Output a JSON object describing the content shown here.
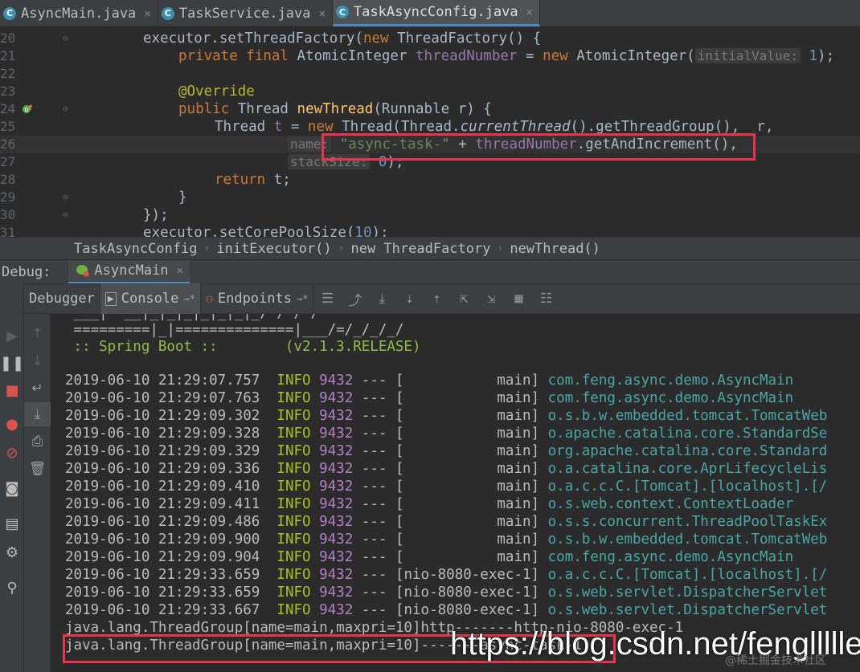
{
  "tabs": [
    {
      "label": "AsyncMain.java",
      "active": false
    },
    {
      "label": "TaskService.java",
      "active": false
    },
    {
      "label": "TaskAsyncConfig.java",
      "active": true
    }
  ],
  "editor": {
    "lines": [
      {
        "num": "20",
        "t1": "executor.setThreadFactory(",
        "t2": "new",
        "t3": " ThreadFactory() {"
      },
      {
        "num": "21",
        "t1": "private final",
        "t2": " AtomicInteger ",
        "t3": "threadNumber",
        "t4": " = ",
        "t5": "new",
        "t6": " AtomicInteger(",
        "hint": "initialValue:",
        "t7": " 1",
        "t8": ");"
      },
      {
        "num": "22"
      },
      {
        "num": "23",
        "t1": "@Override"
      },
      {
        "num": "24",
        "t1": "public",
        "t2": " Thread ",
        "t3": "newThread",
        "t4": "(Runnable r) {"
      },
      {
        "num": "25",
        "t1": "Thread ",
        "t2": "t",
        "t3": " = ",
        "t4": "new",
        "t5": " Thread(Thread.",
        "t6": "currentThread",
        "t7": "().getThreadGroup(),  r,"
      },
      {
        "num": "26",
        "hint": "name:",
        "t1": " \"async-task-\"",
        "t2": " + ",
        "t3": "threadNumber",
        "t4": ".getAndIncrement(),"
      },
      {
        "num": "27",
        "hint": "stackSize:",
        "t1": " 0",
        "t2": ");"
      },
      {
        "num": "28",
        "t1": "return",
        "t2": " t;"
      },
      {
        "num": "29",
        "t1": "}"
      },
      {
        "num": "30",
        "t1": "});"
      },
      {
        "num": "31",
        "t1": "executor.setCorePoolSize(",
        "t2": "10",
        "t3": ");"
      }
    ]
  },
  "breadcrumb": [
    "TaskAsyncConfig",
    "initExecutor()",
    "new ThreadFactory",
    "newThread()"
  ],
  "debug": {
    "label": "Debug:",
    "run_tab": "AsyncMain",
    "tabs": [
      "Debugger",
      "Console",
      "Endpoints"
    ]
  },
  "console": {
    "banner1": " =========|_|==============|___/=/_/_/_/",
    "banner2": " :: Spring Boot ::        (v2.1.3.RELEASE)",
    "logs": [
      {
        "ts": "2019-06-10 21:29:07.757",
        "level": "INFO",
        "pid": "9432",
        "thread": "[           main]",
        "cls": "com.feng.async.demo.AsyncMain"
      },
      {
        "ts": "2019-06-10 21:29:07.763",
        "level": "INFO",
        "pid": "9432",
        "thread": "[           main]",
        "cls": "com.feng.async.demo.AsyncMain"
      },
      {
        "ts": "2019-06-10 21:29:09.302",
        "level": "INFO",
        "pid": "9432",
        "thread": "[           main]",
        "cls": "o.s.b.w.embedded.tomcat.TomcatWeb"
      },
      {
        "ts": "2019-06-10 21:29:09.328",
        "level": "INFO",
        "pid": "9432",
        "thread": "[           main]",
        "cls": "o.apache.catalina.core.StandardSe"
      },
      {
        "ts": "2019-06-10 21:29:09.329",
        "level": "INFO",
        "pid": "9432",
        "thread": "[           main]",
        "cls": "org.apache.catalina.core.Standard"
      },
      {
        "ts": "2019-06-10 21:29:09.336",
        "level": "INFO",
        "pid": "9432",
        "thread": "[           main]",
        "cls": "o.a.catalina.core.AprLifecycleLis"
      },
      {
        "ts": "2019-06-10 21:29:09.410",
        "level": "INFO",
        "pid": "9432",
        "thread": "[           main]",
        "cls": "o.a.c.c.C.[Tomcat].[localhost].[/"
      },
      {
        "ts": "2019-06-10 21:29:09.411",
        "level": "INFO",
        "pid": "9432",
        "thread": "[           main]",
        "cls": "o.s.web.context.ContextLoader"
      },
      {
        "ts": "2019-06-10 21:29:09.486",
        "level": "INFO",
        "pid": "9432",
        "thread": "[           main]",
        "cls": "o.s.s.concurrent.ThreadPoolTaskEx"
      },
      {
        "ts": "2019-06-10 21:29:09.900",
        "level": "INFO",
        "pid": "9432",
        "thread": "[           main]",
        "cls": "o.s.b.w.embedded.tomcat.TomcatWeb"
      },
      {
        "ts": "2019-06-10 21:29:09.904",
        "level": "INFO",
        "pid": "9432",
        "thread": "[           main]",
        "cls": "com.feng.async.demo.AsyncMain"
      },
      {
        "ts": "2019-06-10 21:29:33.659",
        "level": "INFO",
        "pid": "9432",
        "thread": "[nio-8080-exec-1]",
        "cls": "o.a.c.c.C.[Tomcat].[localhost].[/"
      },
      {
        "ts": "2019-06-10 21:29:33.659",
        "level": "INFO",
        "pid": "9432",
        "thread": "[nio-8080-exec-1]",
        "cls": "o.s.web.servlet.DispatcherServlet"
      },
      {
        "ts": "2019-06-10 21:29:33.667",
        "level": "INFO",
        "pid": "9432",
        "thread": "[nio-8080-exec-1]",
        "cls": "o.s.web.servlet.DispatcherServlet"
      }
    ],
    "out1": "java.lang.ThreadGroup[name=main,maxpri=10]http-------http-nio-8080-exec-1",
    "out2": "java.lang.ThreadGroup[name=main,maxpri=10]-------async-task-1"
  },
  "watermark": "https://blog.csdn.net/fengllllle",
  "watermark2": "@稀土掘金技术社区"
}
